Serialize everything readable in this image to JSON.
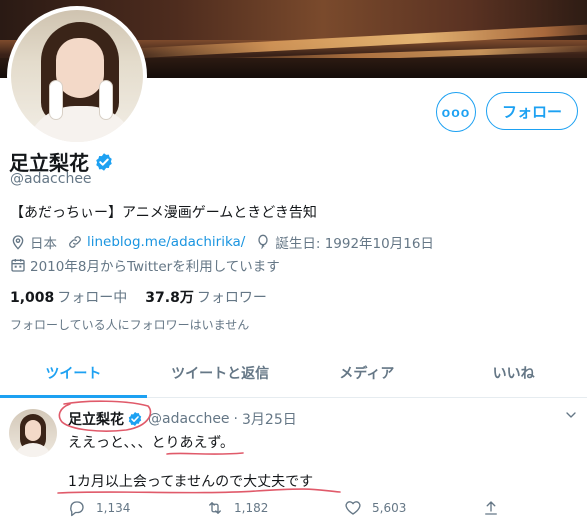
{
  "profile": {
    "display_name": "足立梨花",
    "handle": "@adacchee",
    "bio": "【あだっちぃー】アニメ漫画ゲームときどき告知",
    "location": "日本",
    "url": "lineblog.me/adachirika/",
    "birthday": "誕生日: 1992年10月16日",
    "joined": "2010年8月からTwitterを利用しています",
    "following_count": "1,008",
    "following_label": "フォロー中",
    "followers_count": "37.8万",
    "followers_label": "フォロワー",
    "no_mutual_note": "フォローしている人にフォロワーはいません"
  },
  "actions": {
    "more_label": "ooo",
    "follow_label": "フォロー"
  },
  "tabs": [
    {
      "label": "ツイート",
      "active": true
    },
    {
      "label": "ツイートと返信",
      "active": false
    },
    {
      "label": "メディア",
      "active": false
    },
    {
      "label": "いいね",
      "active": false
    }
  ],
  "tweet": {
    "name": "足立梨花",
    "handle": "@adacchee",
    "dot": "·",
    "date": "3月25日",
    "line1": "ええっと、、、とりあえず。",
    "line2": "1カ月以上会ってませんので大丈夫です",
    "replies": "1,134",
    "retweets": "1,182",
    "likes": "5,603"
  },
  "colors": {
    "accent": "#1da1f2",
    "link": "#1b95e0",
    "secondary_text": "#657786",
    "annotation": "#e05a6a"
  }
}
